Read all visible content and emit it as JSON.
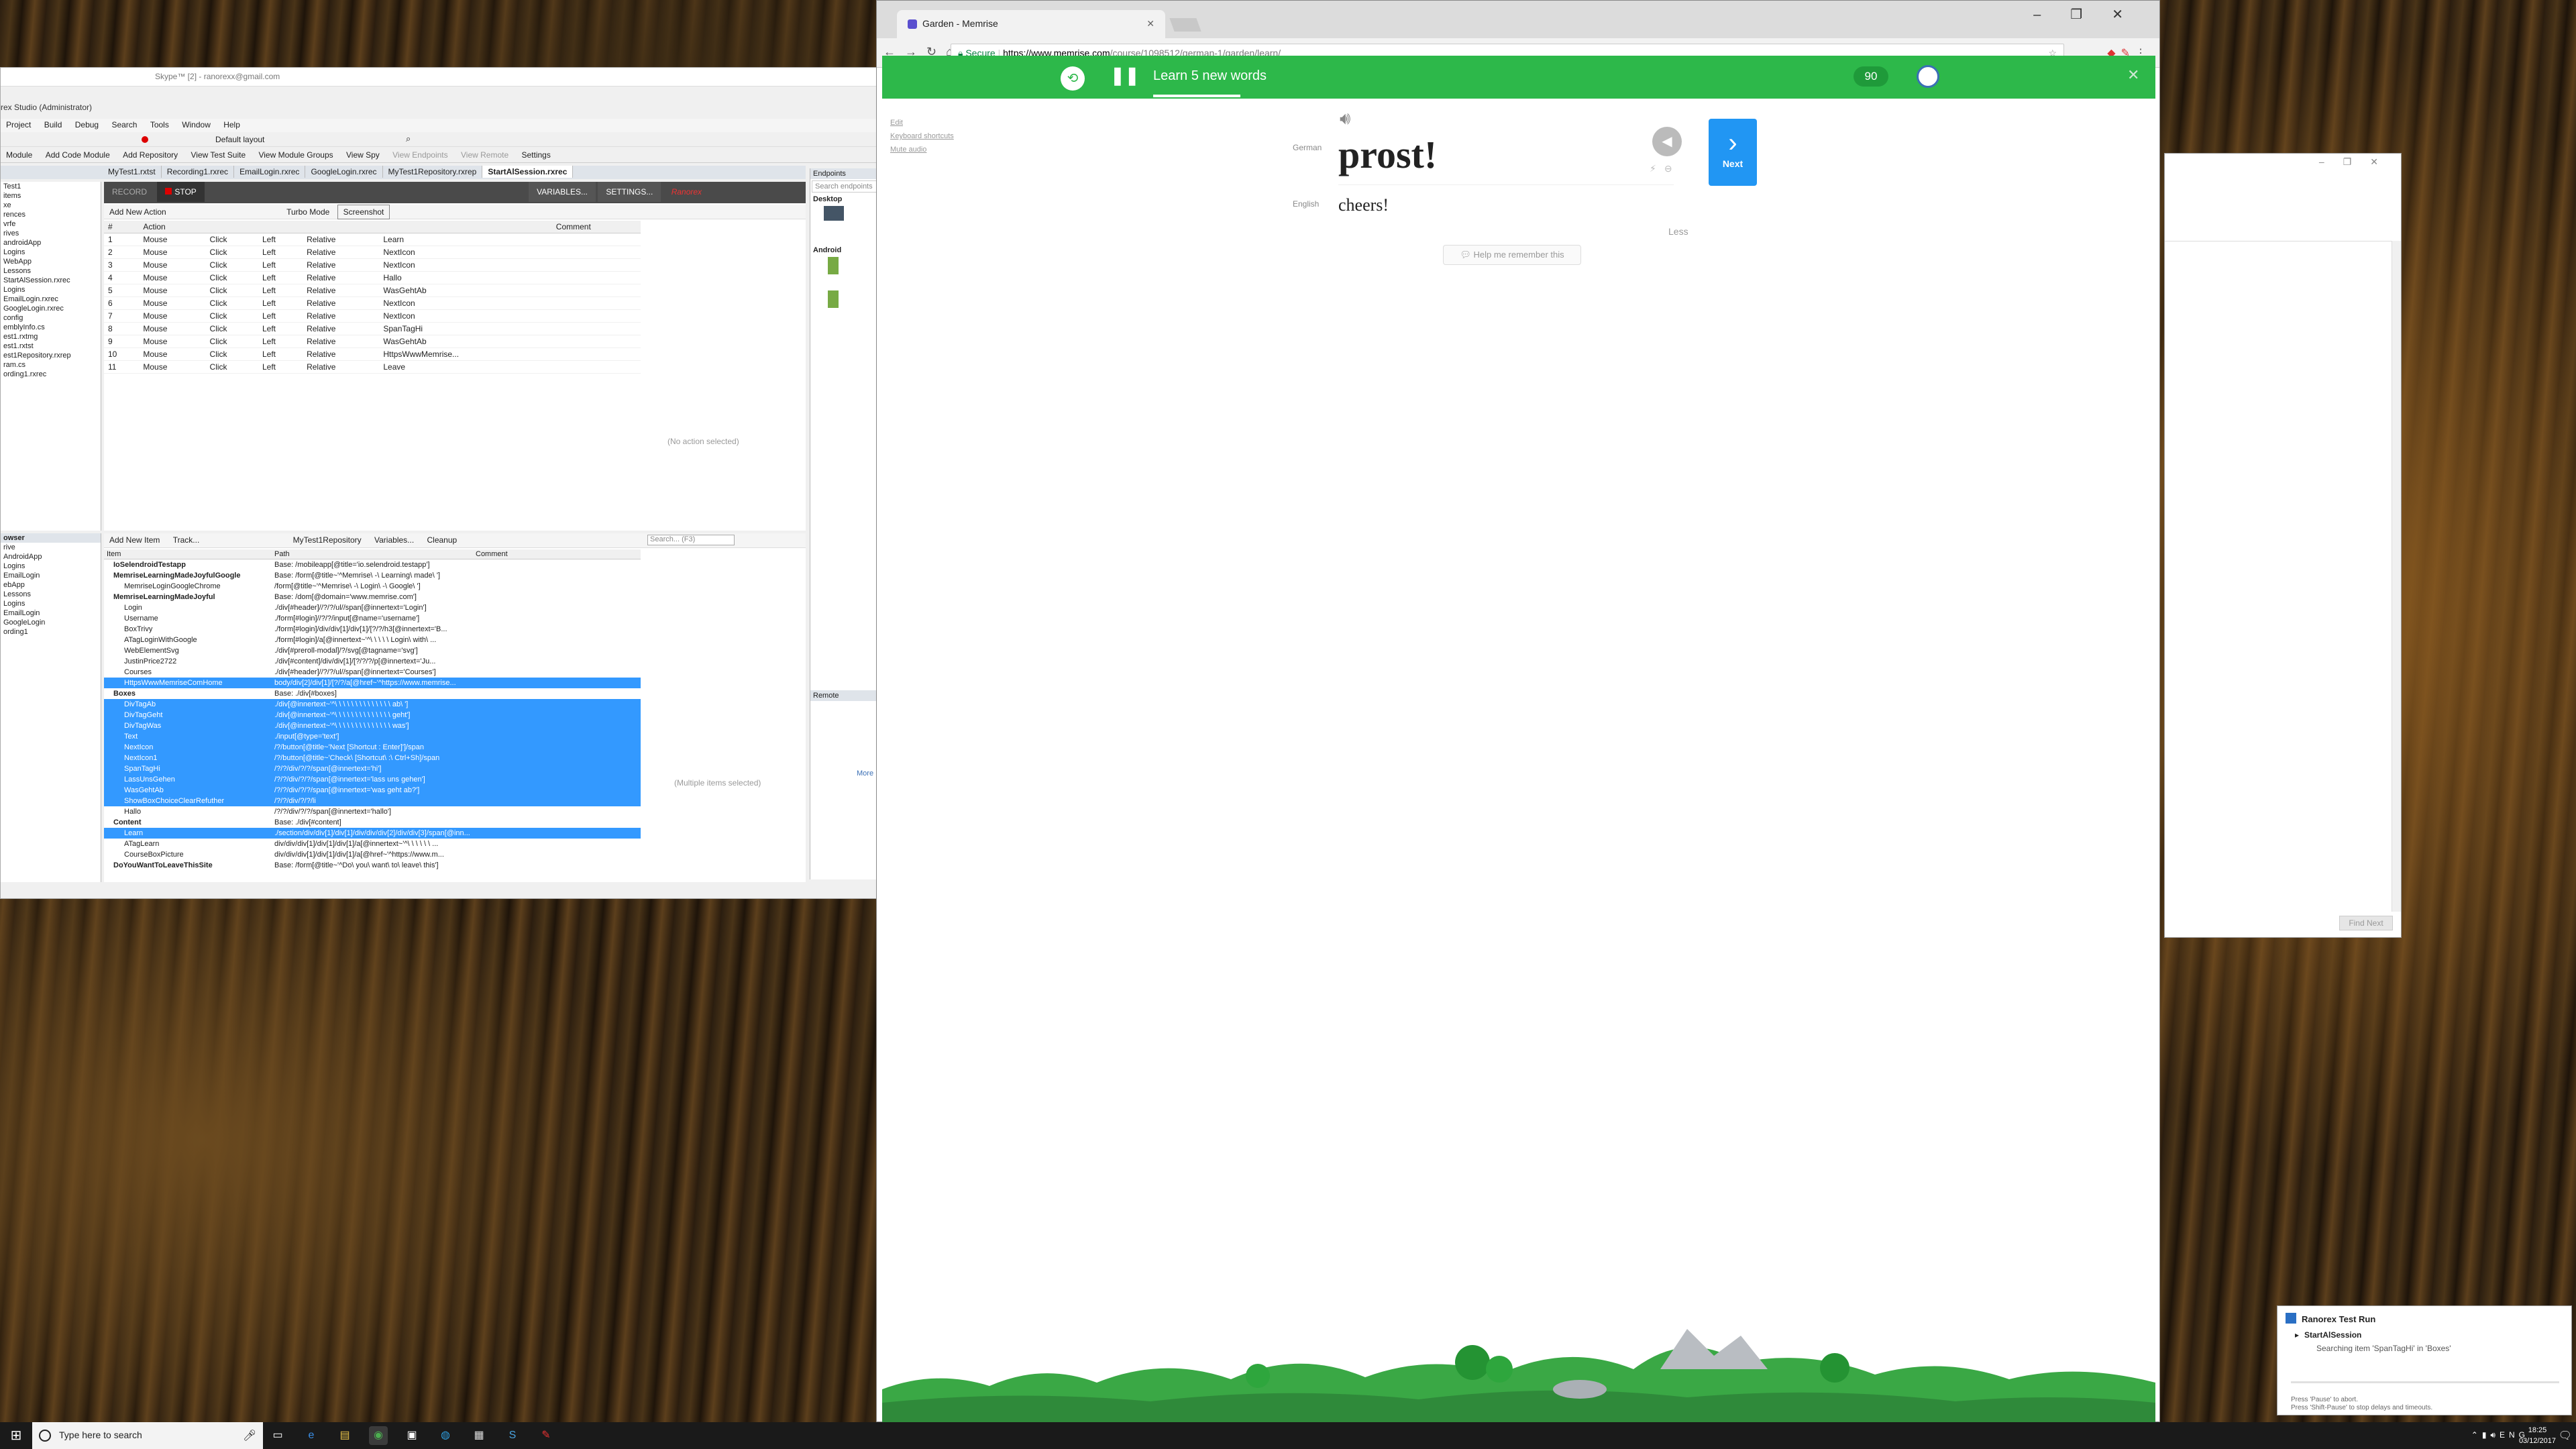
{
  "ranorex": {
    "title": "Skype™ [2] - ranorexx@gmail.com",
    "subtitle": "rex Studio (Administrator)",
    "menu": [
      "Project",
      "Build",
      "Debug",
      "Search",
      "Tools",
      "Window",
      "Help"
    ],
    "layout_label": "Default layout",
    "toolbar2": [
      "Module",
      "Add Code Module",
      "Add Repository",
      "View Test Suite",
      "View Module Groups",
      "View Spy",
      "View Endpoints",
      "View Remote",
      "Settings"
    ],
    "doc_tabs": [
      "MyTest1.rxtst",
      "Recording1.rxrec",
      "EmailLogin.rxrec",
      "GoogleLogin.rxrec",
      "MyTest1Repository.rxrep",
      "StartAlSession.rxrec"
    ],
    "active_doc_tab": "StartAlSession.rxrec",
    "left_tree_top": [
      "Test1",
      "items",
      "xe",
      "rences",
      "vrfe",
      "rives",
      "androidApp",
      "Logins",
      "WebApp",
      "Lessons",
      "StartAlSession.rxrec",
      "Logins",
      "EmailLogin.rxrec",
      "GoogleLogin.rxrec",
      "config",
      "emblyInfo.cs",
      "est1.rxtmg",
      "est1.rxtst",
      "est1Repository.rxrep",
      "ram.cs",
      "ording1.rxrec"
    ],
    "left_tree_bottom_title": "owser",
    "left_tree_bottom": [
      "rive",
      "AndroidApp",
      "Logins",
      "EmailLogin",
      "ebApp",
      "Lessons",
      "Logins",
      "EmailLogin",
      "GoogleLogin",
      "ording1"
    ],
    "recorder": {
      "record_label": "RECORD",
      "stop_label": "STOP",
      "variables_label": "VARIABLES...",
      "settings_label": "SETTINGS...",
      "brand_label": "Ranorex",
      "add_action_label": "Add New Action",
      "turbo_label": "Turbo Mode",
      "screenshot_label": "Screenshot",
      "columns": [
        "#",
        "Action",
        "",
        "",
        "",
        "",
        "Comment"
      ],
      "rows": [
        {
          "n": "1",
          "type": "Mouse",
          "action": "Click",
          "button": "Left",
          "loc": "Relative",
          "item": "Learn"
        },
        {
          "n": "2",
          "type": "Mouse",
          "action": "Click",
          "button": "Left",
          "loc": "Relative",
          "item": "NextIcon"
        },
        {
          "n": "3",
          "type": "Mouse",
          "action": "Click",
          "button": "Left",
          "loc": "Relative",
          "item": "NextIcon"
        },
        {
          "n": "4",
          "type": "Mouse",
          "action": "Click",
          "button": "Left",
          "loc": "Relative",
          "item": "Hallo"
        },
        {
          "n": "5",
          "type": "Mouse",
          "action": "Click",
          "button": "Left",
          "loc": "Relative",
          "item": "WasGehtAb"
        },
        {
          "n": "6",
          "type": "Mouse",
          "action": "Click",
          "button": "Left",
          "loc": "Relative",
          "item": "NextIcon"
        },
        {
          "n": "7",
          "type": "Mouse",
          "action": "Click",
          "button": "Left",
          "loc": "Relative",
          "item": "NextIcon"
        },
        {
          "n": "8",
          "type": "Mouse",
          "action": "Click",
          "button": "Left",
          "loc": "Relative",
          "item": "SpanTagHi"
        },
        {
          "n": "9",
          "type": "Mouse",
          "action": "Click",
          "button": "Left",
          "loc": "Relative",
          "item": "WasGehtAb"
        },
        {
          "n": "10",
          "type": "Mouse",
          "action": "Click",
          "button": "Left",
          "loc": "Relative",
          "item": "HttpsWwwMemrise..."
        },
        {
          "n": "11",
          "type": "Mouse",
          "action": "Click",
          "button": "Left",
          "loc": "Relative",
          "item": "Leave"
        }
      ],
      "empty_label": "(No action selected)"
    },
    "repository": {
      "add_item_label": "Add New Item",
      "track_label": "Track...",
      "repo_name": "MyTest1Repository",
      "variables_label": "Variables...",
      "cleanup_label": "Cleanup",
      "search_placeholder": "Search... (F3)",
      "columns": [
        "Item",
        "Path",
        "Comment"
      ],
      "rows": [
        {
          "item": "IoSelendroidTestapp",
          "path": "Base: /mobileapp[@title='io.selendroid.testapp']",
          "sel": false,
          "bold": true
        },
        {
          "item": "MemriseLearningMadeJoyfulGoogle",
          "path": "Base: /form[@title~'^Memrise\\ -\\ Learning\\ made\\ ']",
          "sel": false,
          "bold": true
        },
        {
          "item": "MemriseLoginGoogleChrome",
          "path": "/form[@title~'^Memrise\\ -\\ Login\\ -\\ Google\\ ']",
          "sel": false,
          "bold": false
        },
        {
          "item": "MemriseLearningMadeJoyful",
          "path": "Base: /dom[@domain='www.memrise.com']",
          "sel": false,
          "bold": true
        },
        {
          "item": "Login",
          "path": "./div[#header]//?/?/ul//span[@innertext='Login']",
          "sel": false,
          "bold": false
        },
        {
          "item": "Username",
          "path": "./form[#login]//?/?/input[@name='username']",
          "sel": false,
          "bold": false
        },
        {
          "item": "BoxTrivy",
          "path": "./form[#login]/div/div[1]/div[1]/[?/?/h3[@innertext='B...",
          "sel": false,
          "bold": false
        },
        {
          "item": "ATagLoginWithGoogle",
          "path": "./form[#login]/a[@innertext~'^\\ \\ \\ \\ \\ Login\\ with\\ ...",
          "sel": false,
          "bold": false
        },
        {
          "item": "WebElementSvg",
          "path": "./div[#preroll-modal]/?/svg[@tagname='svg']",
          "sel": false,
          "bold": false
        },
        {
          "item": "JustinPrice2722",
          "path": "./div[#content]/div/div[1]/[?/?/?/p[@innertext='Ju...",
          "sel": false,
          "bold": false
        },
        {
          "item": "Courses",
          "path": "./div[#header]//?/?/ul//span[@innertext='Courses']",
          "sel": false,
          "bold": false
        },
        {
          "item": "HttpsWwwMemriseComHome",
          "path": "body/div[2]/div[1]/[?/?/a[@href~'^https://www.memrise...",
          "sel": true,
          "bold": false
        },
        {
          "item": "Boxes",
          "path": "Base: ./div[#boxes]",
          "sel": false,
          "bold": true
        },
        {
          "item": "DivTagAb",
          "path": "./div[@innertext~'^\\ \\ \\ \\ \\ \\ \\ \\ \\ \\ \\ \\ \\ \\ ab\\ ']",
          "sel": true,
          "bold": false
        },
        {
          "item": "DivTagGeht",
          "path": "./div[@innertext~'^\\ \\ \\ \\ \\ \\ \\ \\ \\ \\ \\ \\ \\ \\ geht']",
          "sel": true,
          "bold": false
        },
        {
          "item": "DivTagWas",
          "path": "./div[@innertext~'^\\ \\ \\ \\ \\ \\ \\ \\ \\ \\ \\ \\ \\ \\ was']",
          "sel": true,
          "bold": false
        },
        {
          "item": "Text",
          "path": "./input[@type='text']",
          "sel": true,
          "bold": false
        },
        {
          "item": "NextIcon",
          "path": "/?/button[@title~'Next [Shortcut : Enter]']/span",
          "sel": true,
          "bold": false
        },
        {
          "item": "NextIcon1",
          "path": "/?/button[@title~'Check\\ [Shortcut\\ :\\ Ctrl+Sh]/span",
          "sel": true,
          "bold": false
        },
        {
          "item": "SpanTagHi",
          "path": "/?/?/div/?/?/span[@innertext='hi']",
          "sel": true,
          "bold": false
        },
        {
          "item": "LassUnsGehen",
          "path": "/?/?/div/?/?/span[@innertext='lass uns gehen']",
          "sel": true,
          "bold": false
        },
        {
          "item": "WasGehtAb",
          "path": "/?/?/div/?/?/span[@innertext='was geht ab?']",
          "sel": true,
          "bold": false
        },
        {
          "item": "ShowBoxChoiceClearRefuther",
          "path": "/?/?/div/?/?/li",
          "sel": true,
          "bold": false
        },
        {
          "item": "Hallo",
          "path": "/?/?/div/?/?/span[@innertext='hallo']",
          "sel": false,
          "bold": false
        },
        {
          "item": "Content",
          "path": "Base: ./div[#content]",
          "sel": false,
          "bold": true
        },
        {
          "item": "Learn",
          "path": "./section/div/div[1]/div[1]/div/div/div[2]/div/div[3]/span[@inn...",
          "sel": true,
          "bold": false
        },
        {
          "item": "ATagLearn",
          "path": "div/div/div[1]/div[1]/div[1]/a[@innertext~'^\\ \\ \\ \\ \\ \\ ...",
          "sel": false,
          "bold": false
        },
        {
          "item": "CourseBoxPicture",
          "path": "div/div/div[1]/div[1]/div[1]/a[@href~'^https://www.m...",
          "sel": false,
          "bold": false
        },
        {
          "item": "DoYouWantToLeaveThisSite",
          "path": "Base: /form[@title~'^Do\\ you\\ want\\ to\\ leave\\ this']",
          "sel": false,
          "bold": true
        }
      ],
      "multi_label": "(Multiple items selected)"
    },
    "endpoints": {
      "title": "Endpoints",
      "search_placeholder": "Search endpoints",
      "desktop_label": "Desktop",
      "android_label": "Android",
      "remote_label": "Remote",
      "more_label": "More"
    }
  },
  "chrome": {
    "tab_title": "Garden - Memrise",
    "secure_label": "Secure",
    "url_host": "https://www.memrise.com",
    "url_path": "/course/1098512/german-1/garden/learn/",
    "window_controls": [
      "–",
      "❐",
      "✕"
    ]
  },
  "memrise": {
    "header_title": "Learn 5 new words",
    "points": "90",
    "progress_fraction": 0.26,
    "side_links": [
      "Edit",
      "Keyboard shortcuts",
      "Mute audio"
    ],
    "german_label": "German",
    "word": "prost!",
    "english_label": "English",
    "translation": "cheers!",
    "less_label": "Less",
    "help_label": "Help me remember this",
    "next_label": "Next",
    "colors": {
      "header": "#2db84a",
      "next": "#2196f3"
    }
  },
  "bgwindow": {
    "button_label": "Find Next"
  },
  "toast": {
    "title": "Ranorex Test Run",
    "item": "StartAlSession",
    "status": "Searching item 'SpanTagHi' in 'Boxes'",
    "hint1": "Press 'Pause' to abort.",
    "hint2": "Press 'Shift-Pause' to stop delays and timeouts."
  },
  "taskbar": {
    "search_placeholder": "Type here to search",
    "lang": "ENG",
    "time": "18:25",
    "date": "03/12/2017"
  }
}
